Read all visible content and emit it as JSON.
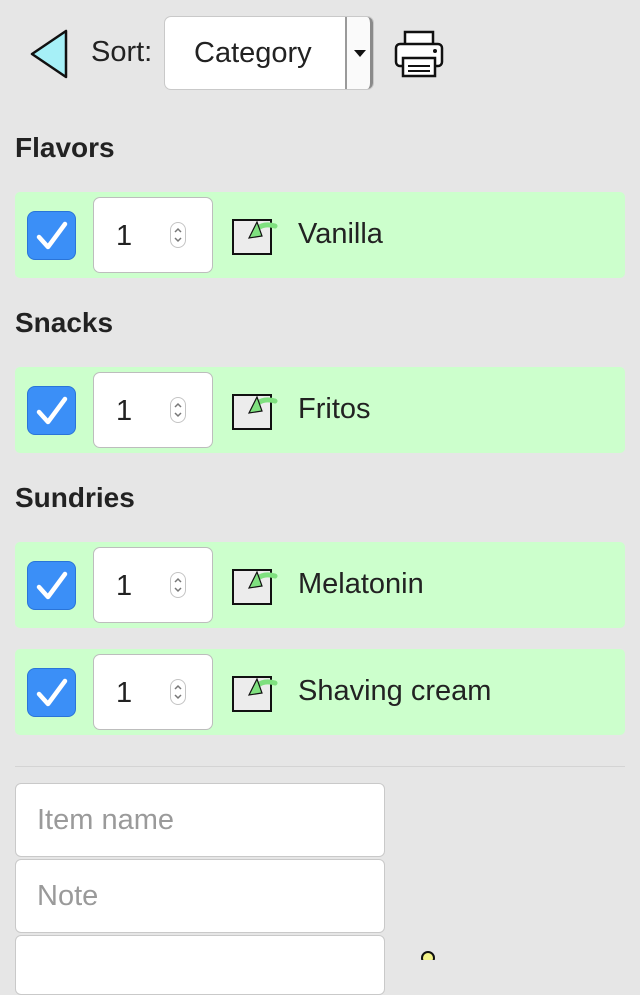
{
  "toolbar": {
    "back_icon": "back-triangle-icon",
    "sort_label": "Sort:",
    "sort_value": "Category",
    "print_icon": "printer-icon"
  },
  "categories": [
    {
      "name": "Flavors",
      "items": [
        {
          "qty": "1",
          "name": "Vanilla",
          "checked": true
        }
      ]
    },
    {
      "name": "Snacks",
      "items": [
        {
          "qty": "1",
          "name": "Fritos",
          "checked": true
        }
      ]
    },
    {
      "name": "Sundries",
      "items": [
        {
          "qty": "1",
          "name": "Melatonin",
          "checked": true
        },
        {
          "qty": "1",
          "name": "Shaving cream",
          "checked": true
        }
      ]
    }
  ],
  "form": {
    "item_name_placeholder": "Item name",
    "note_placeholder": "Note"
  },
  "colors": {
    "background": "#e6e6e6",
    "item_row": "#ccffcc",
    "checkbox": "#3b8ff7",
    "back_arrow_fill": "#a6f0f7",
    "move_arrow": "#7fe07f"
  }
}
